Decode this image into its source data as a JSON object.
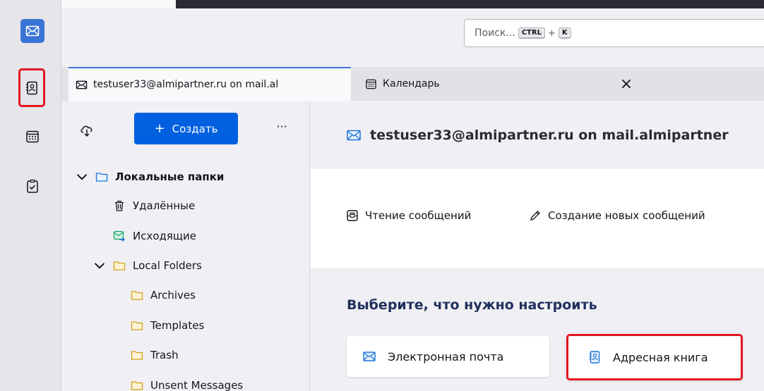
{
  "search": {
    "placeholder": "Поиск...",
    "kbd_ctrl": "CTRL",
    "kbd_plus": "+",
    "kbd_key": "K"
  },
  "tabs": [
    {
      "label": "testuser33@almipartner.ru on mail.al",
      "icon": "envelope-icon"
    },
    {
      "label": "Календарь",
      "icon": "calendar-icon"
    }
  ],
  "tab_close": "×",
  "folder_pane": {
    "create_label": "Создать",
    "create_plus": "+",
    "more_label": "···",
    "tree": {
      "local_root": "Локальные папки",
      "deleted": "Удалённые",
      "outbox": "Исходящие",
      "local_folders": "Local Folders",
      "archives": "Archives",
      "templates": "Templates",
      "trash": "Trash",
      "unsent": "Unsent Messages"
    }
  },
  "main": {
    "account_title": "testuser33@almipartner.ru on mail.almipartner",
    "actions": {
      "read": "Чтение сообщений",
      "compose": "Создание новых сообщений"
    },
    "setup_title": "Выберите, что нужно настроить",
    "setup_cards": {
      "email": "Электронная почта",
      "address_book": "Адресная книга"
    }
  },
  "colors": {
    "accent": "#0060df",
    "highlight_red": "#e4151e",
    "mail_space_bg": "#3a74d6"
  }
}
